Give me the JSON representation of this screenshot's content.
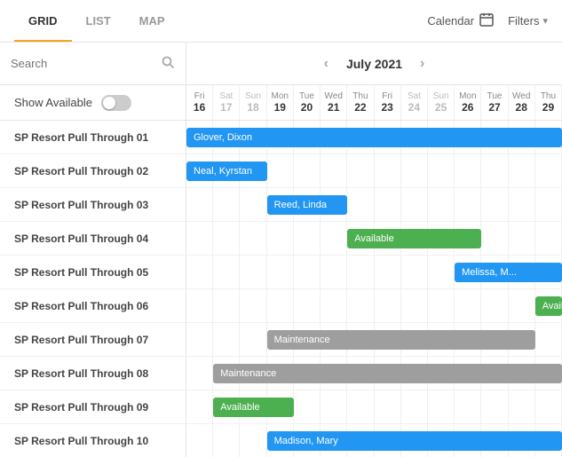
{
  "nav": {
    "tabs": [
      {
        "id": "grid",
        "label": "GRID",
        "active": true
      },
      {
        "id": "list",
        "label": "LIST",
        "active": false
      },
      {
        "id": "map",
        "label": "MAP",
        "active": false
      }
    ],
    "calendar_label": "Calendar",
    "filters_label": "Filters"
  },
  "search": {
    "placeholder": "Search"
  },
  "month_nav": {
    "label": "July 2021"
  },
  "show_available": {
    "label": "Show Available"
  },
  "days": [
    {
      "name": "Fri",
      "num": "16",
      "weekend": false
    },
    {
      "name": "Sat",
      "num": "17",
      "weekend": true
    },
    {
      "name": "Sun",
      "num": "18",
      "weekend": true
    },
    {
      "name": "Mon",
      "num": "19",
      "weekend": false
    },
    {
      "name": "Tue",
      "num": "20",
      "weekend": false
    },
    {
      "name": "Wed",
      "num": "21",
      "weekend": false
    },
    {
      "name": "Thu",
      "num": "22",
      "weekend": false
    },
    {
      "name": "Fri",
      "num": "23",
      "weekend": false
    },
    {
      "name": "Sat",
      "num": "24",
      "weekend": true
    },
    {
      "name": "Sun",
      "num": "25",
      "weekend": true
    },
    {
      "name": "Mon",
      "num": "26",
      "weekend": false
    },
    {
      "name": "Tue",
      "num": "27",
      "weekend": false
    },
    {
      "name": "Wed",
      "num": "28",
      "weekend": false
    },
    {
      "name": "Thu",
      "num": "29",
      "weekend": false
    }
  ],
  "rows": [
    {
      "label": "SP Resort Pull Through 01",
      "bars": [
        {
          "text": "Glover, Dixon",
          "color": "blue",
          "start": 0,
          "span": 14
        }
      ]
    },
    {
      "label": "SP Resort Pull Through 02",
      "bars": [
        {
          "text": "Neal, Kyrstan",
          "color": "blue",
          "start": 0,
          "span": 3
        }
      ]
    },
    {
      "label": "SP Resort Pull Through 03",
      "bars": [
        {
          "text": "Reed, Linda",
          "color": "blue",
          "start": 3,
          "span": 3
        }
      ]
    },
    {
      "label": "SP Resort Pull Through 04",
      "bars": [
        {
          "text": "Available",
          "color": "green",
          "start": 6,
          "span": 5
        }
      ]
    },
    {
      "label": "SP Resort Pull Through 05",
      "bars": [
        {
          "text": "Melissa, M...",
          "color": "blue",
          "start": 10,
          "span": 4
        }
      ]
    },
    {
      "label": "SP Resort Pull Through 06",
      "bars": [
        {
          "text": "Available",
          "color": "green",
          "start": 13,
          "span": 1
        }
      ]
    },
    {
      "label": "SP Resort Pull Through 07",
      "bars": [
        {
          "text": "Maintenance",
          "color": "gray",
          "start": 3,
          "span": 10
        }
      ]
    },
    {
      "label": "SP Resort Pull Through 08",
      "bars": [
        {
          "text": "Maintenance",
          "color": "gray",
          "start": 1,
          "span": 13
        }
      ]
    },
    {
      "label": "SP Resort Pull Through 09",
      "bars": [
        {
          "text": "Available",
          "color": "green",
          "start": 1,
          "span": 3
        }
      ]
    },
    {
      "label": "SP Resort Pull Through 10",
      "bars": [
        {
          "text": "Madison, Mary",
          "color": "blue",
          "start": 3,
          "span": 11
        }
      ]
    }
  ],
  "colors": {
    "active_tab_underline": "#f5a623",
    "blue_bar": "#2196f3",
    "green_bar": "#4caf50",
    "gray_bar": "#9e9e9e"
  }
}
